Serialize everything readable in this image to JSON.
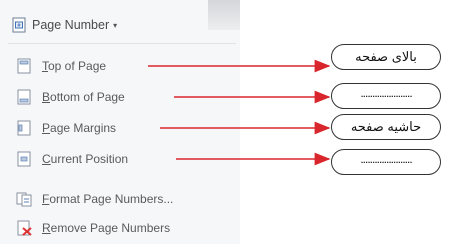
{
  "ribbon": {
    "page_number_label": "Page Number",
    "dropdown_glyph": "▾"
  },
  "menu": {
    "items": [
      {
        "label": "Top of Page",
        "icon": "page-top-icon"
      },
      {
        "label": "Bottom of Page",
        "icon": "page-bottom-icon"
      },
      {
        "label": "Page Margins",
        "icon": "page-margins-icon"
      },
      {
        "label": "Current Position",
        "icon": "current-position-icon"
      },
      {
        "label": "Format Page Numbers...",
        "icon": "format-page-numbers-icon"
      },
      {
        "label": "Remove Page Numbers",
        "icon": "remove-page-numbers-icon"
      }
    ]
  },
  "callouts": [
    {
      "text": "بالای صفحه"
    },
    {
      "text": "......................"
    },
    {
      "text": "حاشیه صفحه"
    },
    {
      "text": "......................"
    }
  ],
  "colors": {
    "arrow": "#d9262c",
    "menu_text": "#5a5a5a",
    "menu_bg": "#f6f7f8"
  }
}
